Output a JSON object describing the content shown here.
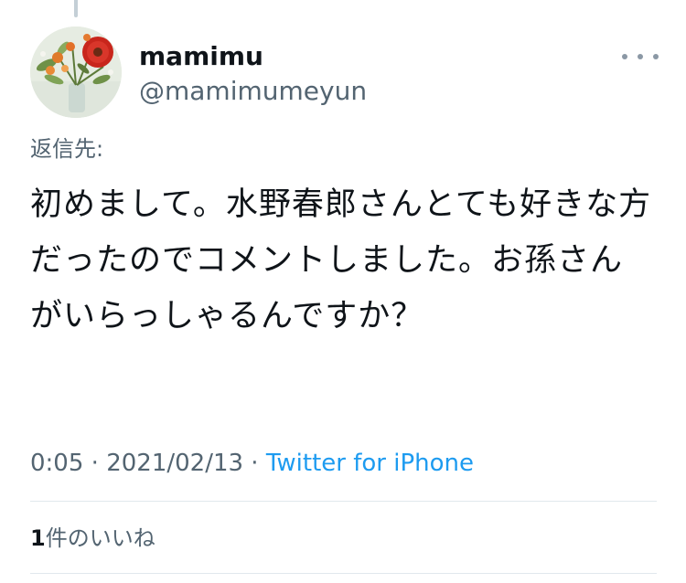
{
  "author": {
    "display_name": "mamimu",
    "handle": "@mamimumeyun"
  },
  "reply_to_label": "返信先:",
  "tweet_text": "初めまして。水野春郎さんとても好きな方だったのでコメントしました。お孫さんがいらっしゃるんですか？",
  "meta": {
    "time": "0:05",
    "separator": " · ",
    "date": "2021/02/13",
    "source": "Twitter for iPhone"
  },
  "likes": {
    "count": "1",
    "label": "件のいいね"
  },
  "icons": {
    "more": "more-horizontal-icon",
    "avatar": "flower-bouquet-avatar"
  },
  "colors": {
    "text": "#0f1419",
    "secondary_text": "#536471",
    "link": "#1d9bf0",
    "divider": "#e1e8ed"
  }
}
